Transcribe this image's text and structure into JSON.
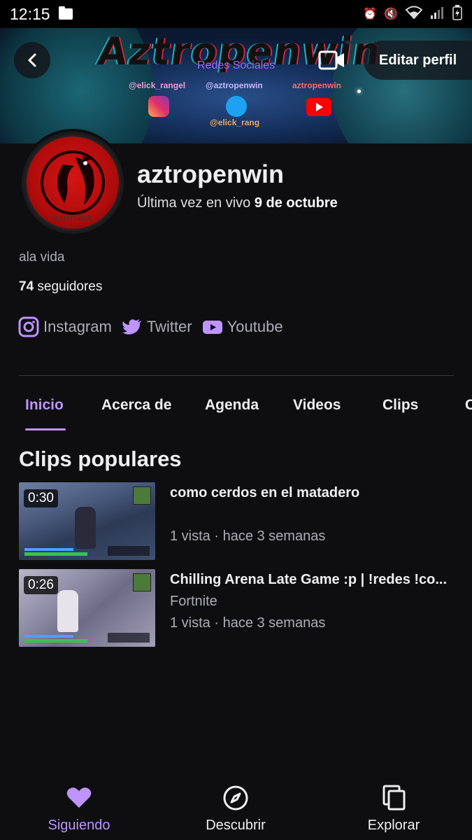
{
  "status_bar": {
    "time": "12:15"
  },
  "banner": {
    "brand_text": "Aztropenwin",
    "redes_label": "Redes Sociales",
    "handles": [
      "@elick_rangel",
      "@aztropenwin",
      "aztropenwin",
      "@elick_rang"
    ]
  },
  "header": {
    "edit_profile": "Editar perfil"
  },
  "profile": {
    "avatar_text": "Aastrolick",
    "username": "aztropenwin",
    "last_live_prefix": "Última vez en vivo ",
    "last_live_date": "9 de octubre",
    "bio": "ala vida",
    "followers_count": "74",
    "followers_label": " seguidores",
    "socials": [
      {
        "label": "Instagram",
        "icon": "instagram-icon"
      },
      {
        "label": "Twitter",
        "icon": "twitter-icon"
      },
      {
        "label": "Youtube",
        "icon": "youtube-icon"
      }
    ]
  },
  "tabs": [
    "Inicio",
    "Acerca de",
    "Agenda",
    "Videos",
    "Clips",
    "C"
  ],
  "section": {
    "title": "Clips populares"
  },
  "clips": [
    {
      "duration": "0:30",
      "title": "como cerdos en el matadero",
      "game": "",
      "meta": "1 vista · hace 3 semanas"
    },
    {
      "duration": "0:26",
      "title": "Chilling Arena Late Game :p | !redes !co...",
      "game": "Fortnite",
      "meta": "1 vista · hace 3 semanas"
    }
  ],
  "bottom_nav": [
    {
      "label": "Siguiendo",
      "icon": "heart-icon",
      "active": true
    },
    {
      "label": "Descubrir",
      "icon": "compass-icon",
      "active": false
    },
    {
      "label": "Explorar",
      "icon": "browse-icon",
      "active": false
    }
  ],
  "colors": {
    "accent": "#bf94ff",
    "background": "#0e0e10",
    "text": "#efeff1",
    "muted": "#adadb8"
  }
}
